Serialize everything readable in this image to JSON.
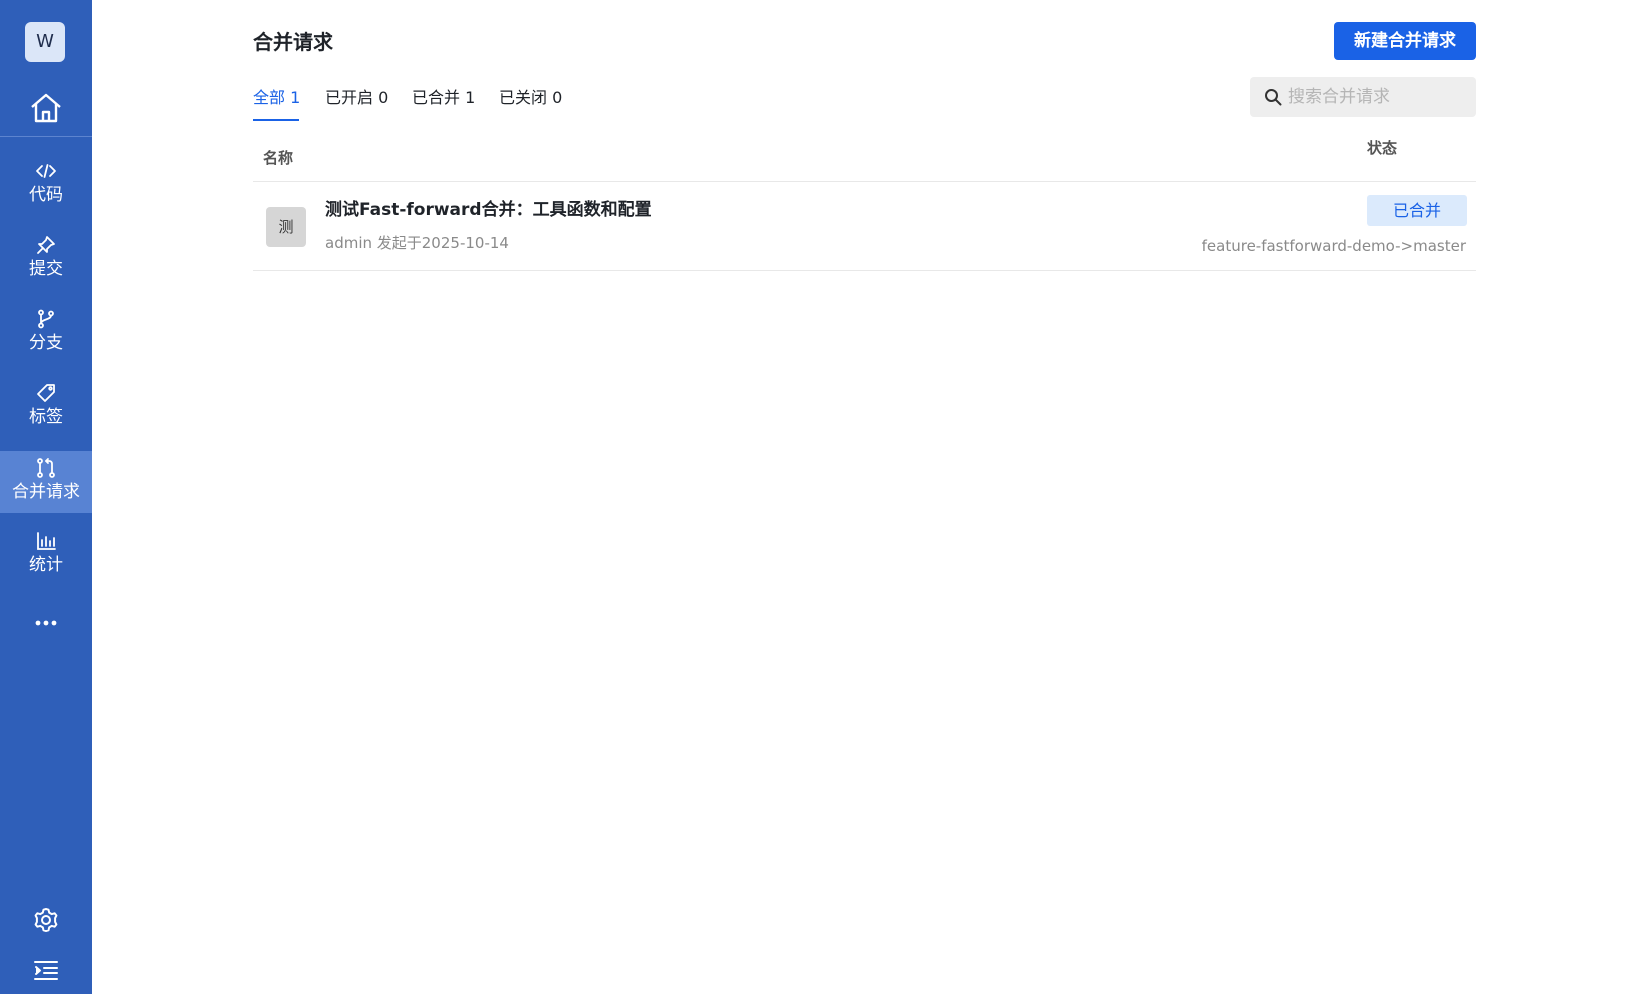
{
  "sidebar": {
    "avatar_letter": "W",
    "items": [
      {
        "label": "代码",
        "icon": "code-icon"
      },
      {
        "label": "提交",
        "icon": "pin-icon"
      },
      {
        "label": "分支",
        "icon": "branch-icon"
      },
      {
        "label": "标签",
        "icon": "tag-icon"
      },
      {
        "label": "合并请求",
        "icon": "merge-request-icon",
        "active": true
      },
      {
        "label": "统计",
        "icon": "bar-chart-icon"
      }
    ]
  },
  "header": {
    "title": "合并请求",
    "new_button": "新建合并请求"
  },
  "tabs": [
    {
      "label": "全部 1",
      "active": true
    },
    {
      "label": "已开启 0"
    },
    {
      "label": "已合并 1"
    },
    {
      "label": "已关闭 0"
    }
  ],
  "search": {
    "placeholder": "搜索合并请求"
  },
  "table": {
    "columns": {
      "name": "名称",
      "status": "状态"
    },
    "rows": [
      {
        "avatar": "测",
        "title": "测试Fast-forward合并：工具函数和配置",
        "meta": "admin 发起于2025-10-14",
        "status": "已合并",
        "branch": "feature-fastforward-demo->master"
      }
    ]
  },
  "colors": {
    "sidebar": "#2f5fb9",
    "sidebar_active": "#5883d3",
    "accent": "#1a62e6",
    "badge_bg": "#dbeafc"
  }
}
